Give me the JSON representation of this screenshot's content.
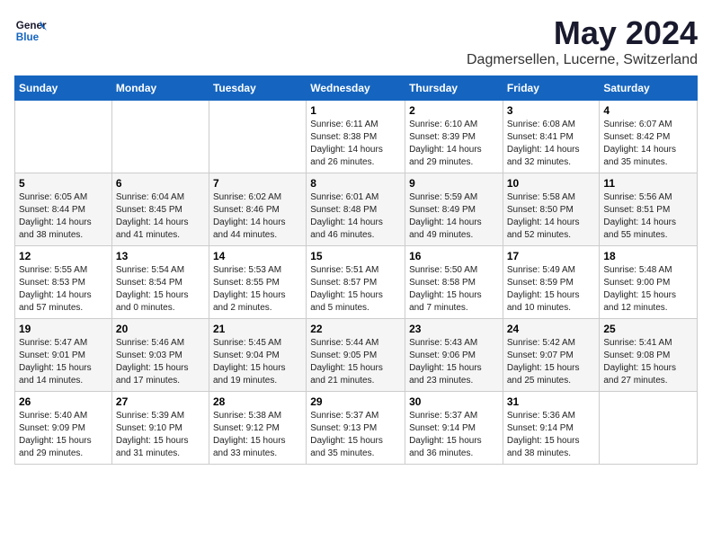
{
  "header": {
    "logo_general": "General",
    "logo_blue": "Blue",
    "month": "May 2024",
    "location": "Dagmersellen, Lucerne, Switzerland"
  },
  "weekdays": [
    "Sunday",
    "Monday",
    "Tuesday",
    "Wednesday",
    "Thursday",
    "Friday",
    "Saturday"
  ],
  "weeks": [
    [
      {
        "day": "",
        "info": ""
      },
      {
        "day": "",
        "info": ""
      },
      {
        "day": "",
        "info": ""
      },
      {
        "day": "1",
        "info": "Sunrise: 6:11 AM\nSunset: 8:38 PM\nDaylight: 14 hours\nand 26 minutes."
      },
      {
        "day": "2",
        "info": "Sunrise: 6:10 AM\nSunset: 8:39 PM\nDaylight: 14 hours\nand 29 minutes."
      },
      {
        "day": "3",
        "info": "Sunrise: 6:08 AM\nSunset: 8:41 PM\nDaylight: 14 hours\nand 32 minutes."
      },
      {
        "day": "4",
        "info": "Sunrise: 6:07 AM\nSunset: 8:42 PM\nDaylight: 14 hours\nand 35 minutes."
      }
    ],
    [
      {
        "day": "5",
        "info": "Sunrise: 6:05 AM\nSunset: 8:44 PM\nDaylight: 14 hours\nand 38 minutes."
      },
      {
        "day": "6",
        "info": "Sunrise: 6:04 AM\nSunset: 8:45 PM\nDaylight: 14 hours\nand 41 minutes."
      },
      {
        "day": "7",
        "info": "Sunrise: 6:02 AM\nSunset: 8:46 PM\nDaylight: 14 hours\nand 44 minutes."
      },
      {
        "day": "8",
        "info": "Sunrise: 6:01 AM\nSunset: 8:48 PM\nDaylight: 14 hours\nand 46 minutes."
      },
      {
        "day": "9",
        "info": "Sunrise: 5:59 AM\nSunset: 8:49 PM\nDaylight: 14 hours\nand 49 minutes."
      },
      {
        "day": "10",
        "info": "Sunrise: 5:58 AM\nSunset: 8:50 PM\nDaylight: 14 hours\nand 52 minutes."
      },
      {
        "day": "11",
        "info": "Sunrise: 5:56 AM\nSunset: 8:51 PM\nDaylight: 14 hours\nand 55 minutes."
      }
    ],
    [
      {
        "day": "12",
        "info": "Sunrise: 5:55 AM\nSunset: 8:53 PM\nDaylight: 14 hours\nand 57 minutes."
      },
      {
        "day": "13",
        "info": "Sunrise: 5:54 AM\nSunset: 8:54 PM\nDaylight: 15 hours\nand 0 minutes."
      },
      {
        "day": "14",
        "info": "Sunrise: 5:53 AM\nSunset: 8:55 PM\nDaylight: 15 hours\nand 2 minutes."
      },
      {
        "day": "15",
        "info": "Sunrise: 5:51 AM\nSunset: 8:57 PM\nDaylight: 15 hours\nand 5 minutes."
      },
      {
        "day": "16",
        "info": "Sunrise: 5:50 AM\nSunset: 8:58 PM\nDaylight: 15 hours\nand 7 minutes."
      },
      {
        "day": "17",
        "info": "Sunrise: 5:49 AM\nSunset: 8:59 PM\nDaylight: 15 hours\nand 10 minutes."
      },
      {
        "day": "18",
        "info": "Sunrise: 5:48 AM\nSunset: 9:00 PM\nDaylight: 15 hours\nand 12 minutes."
      }
    ],
    [
      {
        "day": "19",
        "info": "Sunrise: 5:47 AM\nSunset: 9:01 PM\nDaylight: 15 hours\nand 14 minutes."
      },
      {
        "day": "20",
        "info": "Sunrise: 5:46 AM\nSunset: 9:03 PM\nDaylight: 15 hours\nand 17 minutes."
      },
      {
        "day": "21",
        "info": "Sunrise: 5:45 AM\nSunset: 9:04 PM\nDaylight: 15 hours\nand 19 minutes."
      },
      {
        "day": "22",
        "info": "Sunrise: 5:44 AM\nSunset: 9:05 PM\nDaylight: 15 hours\nand 21 minutes."
      },
      {
        "day": "23",
        "info": "Sunrise: 5:43 AM\nSunset: 9:06 PM\nDaylight: 15 hours\nand 23 minutes."
      },
      {
        "day": "24",
        "info": "Sunrise: 5:42 AM\nSunset: 9:07 PM\nDaylight: 15 hours\nand 25 minutes."
      },
      {
        "day": "25",
        "info": "Sunrise: 5:41 AM\nSunset: 9:08 PM\nDaylight: 15 hours\nand 27 minutes."
      }
    ],
    [
      {
        "day": "26",
        "info": "Sunrise: 5:40 AM\nSunset: 9:09 PM\nDaylight: 15 hours\nand 29 minutes."
      },
      {
        "day": "27",
        "info": "Sunrise: 5:39 AM\nSunset: 9:10 PM\nDaylight: 15 hours\nand 31 minutes."
      },
      {
        "day": "28",
        "info": "Sunrise: 5:38 AM\nSunset: 9:12 PM\nDaylight: 15 hours\nand 33 minutes."
      },
      {
        "day": "29",
        "info": "Sunrise: 5:37 AM\nSunset: 9:13 PM\nDaylight: 15 hours\nand 35 minutes."
      },
      {
        "day": "30",
        "info": "Sunrise: 5:37 AM\nSunset: 9:14 PM\nDaylight: 15 hours\nand 36 minutes."
      },
      {
        "day": "31",
        "info": "Sunrise: 5:36 AM\nSunset: 9:14 PM\nDaylight: 15 hours\nand 38 minutes."
      },
      {
        "day": "",
        "info": ""
      }
    ]
  ]
}
